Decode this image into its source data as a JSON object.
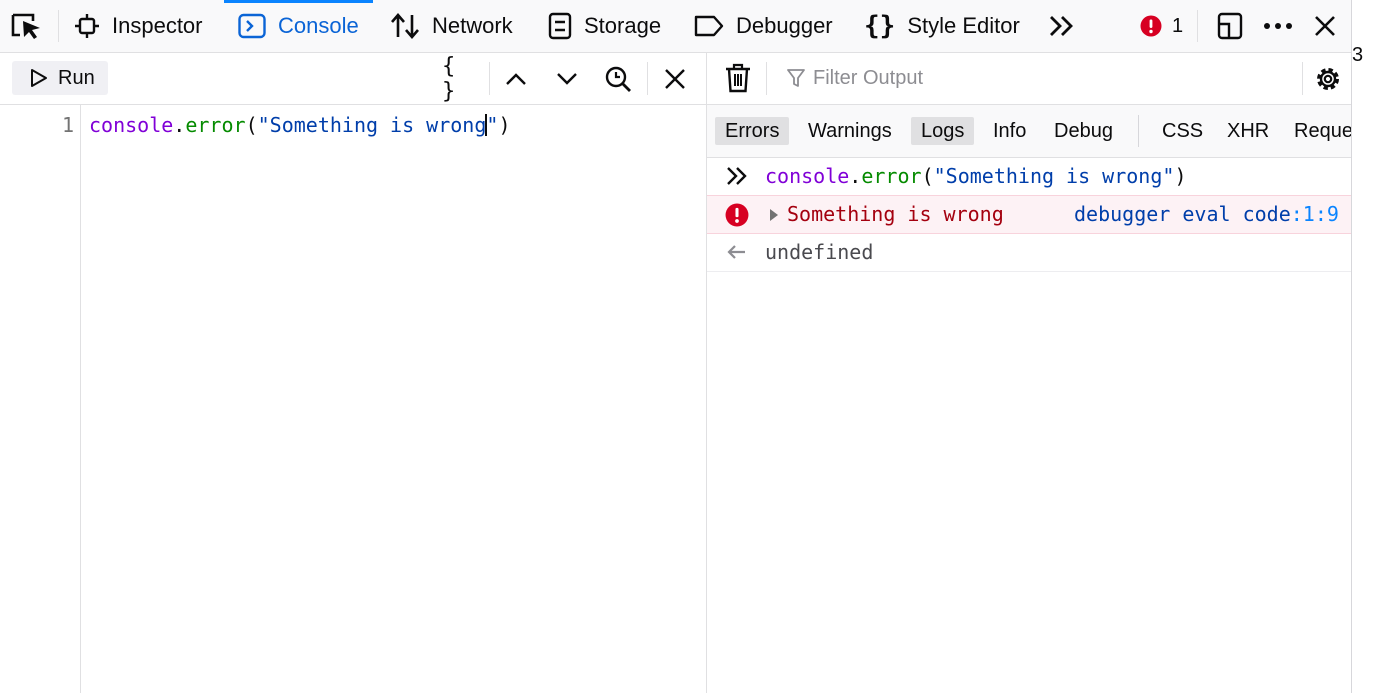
{
  "toolbar": {
    "tabs": [
      {
        "label": "Inspector",
        "icon": "inspector-icon"
      },
      {
        "label": "Console",
        "icon": "console-icon",
        "active": true
      },
      {
        "label": "Network",
        "icon": "network-icon"
      },
      {
        "label": "Storage",
        "icon": "storage-icon"
      },
      {
        "label": "Debugger",
        "icon": "debugger-icon"
      },
      {
        "label": "Style Editor",
        "icon": "style-editor-icon"
      }
    ],
    "error_count": "1",
    "icons": [
      "element-picker-icon",
      "overflow-chevron-icon",
      "error-icon",
      "responsive-design-icon",
      "more-options-icon",
      "close-icon"
    ]
  },
  "editor": {
    "run_label": "Run",
    "braces_label": "{ }",
    "line_number": "1",
    "code": {
      "object": "console",
      "dot": ".",
      "method": "error",
      "open": "(",
      "string_before_caret": "\"Something is wrong",
      "string_after_caret": "\"",
      "close": ")"
    },
    "icons": [
      "play-icon",
      "pretty-print-icon",
      "history-up-icon",
      "history-down-icon",
      "reverse-search-icon",
      "close-editor-icon"
    ]
  },
  "output": {
    "filter_placeholder": "Filter Output",
    "filters": [
      {
        "label": "Errors",
        "active": true
      },
      {
        "label": "Warnings",
        "active": false
      },
      {
        "label": "Logs",
        "active": true
      },
      {
        "label": "Info",
        "active": false
      },
      {
        "label": "Debug",
        "active": false
      },
      {
        "label": "CSS",
        "active": false
      },
      {
        "label": "XHR",
        "active": false
      },
      {
        "label": "Reque",
        "active": false
      }
    ],
    "messages": {
      "input": {
        "object": "console",
        "dot": ".",
        "method": "error",
        "open": "(",
        "string": "\"Something is wrong\"",
        "close": ")"
      },
      "error": {
        "text": "Something is wrong",
        "location": "debugger eval code",
        "line_col": ":1:9"
      },
      "result": {
        "text": "undefined"
      }
    },
    "edge_glyph": "3"
  },
  "colors": {
    "accent": "#0a84ff",
    "active_tab_text": "#0a64d6",
    "error_red": "#d70022",
    "error_text": "#a4000f",
    "error_bg": "#fdf2f5",
    "code_object": "#8000d7",
    "code_function": "#058b00",
    "code_string": "#003eaa"
  }
}
